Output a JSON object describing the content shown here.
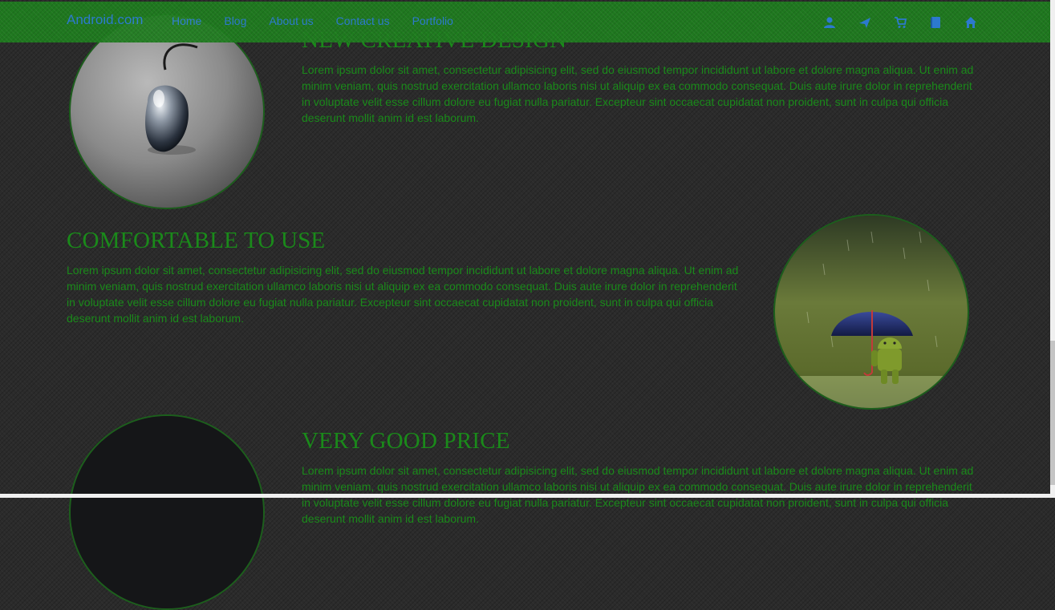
{
  "nav": {
    "brand": "Android.com",
    "links": [
      "Home",
      "Blog",
      "About us",
      "Contact us",
      "Portfolio"
    ],
    "icons": [
      "user-icon",
      "send-icon",
      "cart-icon",
      "book-icon",
      "home-icon"
    ],
    "color": "#2d7fd8",
    "background": "#1f7d1f"
  },
  "features": [
    {
      "title": "NEW CREATIVE DESIGN",
      "text": "Lorem ipsum dolor sit amet, consectetur adipisicing elit, sed do eiusmod tempor incididunt ut labore et dolore magna aliqua. Ut enim ad minim veniam, quis nostrud exercitation ullamco laboris nisi ut aliquip ex ea commodo consequat. Duis aute irure dolor in reprehenderit in voluptate velit esse cillum dolore eu fugiat nulla pariatur. Excepteur sint occaecat cupidatat non proident, sunt in culpa qui officia deserunt mollit anim id est laborum.",
      "image": "glass-cherry"
    },
    {
      "title": "COMFORTABLE TO USE",
      "text": "Lorem ipsum dolor sit amet, consectetur adipisicing elit, sed do eiusmod tempor incididunt ut labore et dolore magna aliqua. Ut enim ad minim veniam, quis nostrud exercitation ullamco laboris nisi ut aliquip ex ea commodo consequat. Duis aute irure dolor in reprehenderit in voluptate velit esse cillum dolore eu fugiat nulla pariatur. Excepteur sint occaecat cupidatat non proident, sunt in culpa qui officia deserunt mollit anim id est laborum.",
      "image": "android-umbrella-rain"
    },
    {
      "title": "VERY GOOD PRICE",
      "text": "Lorem ipsum dolor sit amet, consectetur adipisicing elit, sed do eiusmod tempor incididunt ut labore et dolore magna aliqua. Ut enim ad minim veniam, quis nostrud exercitation ullamco laboris nisi ut aliquip ex ea commodo consequat. Duis aute irure dolor in reprehenderit in voluptate velit esse cillum dolore eu fugiat nulla pariatur. Excepteur sint occaecat cupidatat non proident, sunt in culpa qui officia deserunt mollit anim id est laborum.",
      "image": "dark-image"
    }
  ],
  "colors": {
    "heading": "#1a8a1a",
    "body_text": "#1a8a1a",
    "page_background": "#2b2b2b",
    "circle_border": "#1c5f1c"
  }
}
